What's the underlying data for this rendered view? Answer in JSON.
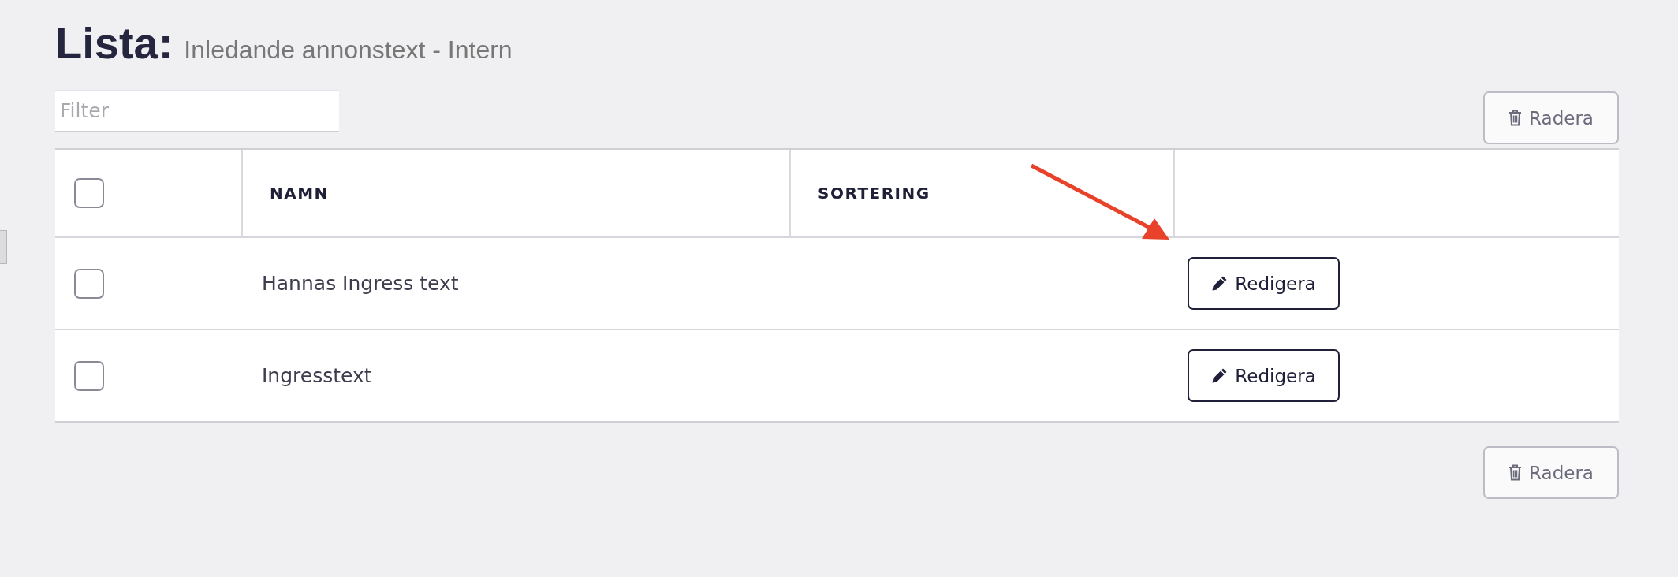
{
  "title": {
    "heading": "Lista:",
    "subtitle": "Inledande annonstext - Intern"
  },
  "filter": {
    "placeholder": "Filter"
  },
  "top_actions": {
    "delete_button": "Radera"
  },
  "table": {
    "select_all": {
      "checked": false
    },
    "columns": [
      "NAMN",
      "SORTERING"
    ],
    "rows": [
      {
        "checked": false,
        "name": "Hannas Ingress text",
        "action": "Redigera"
      },
      {
        "checked": false,
        "name": "Ingresstext",
        "action": "Redigera"
      }
    ]
  },
  "bottom_actions": {
    "delete_button": "Radera"
  }
}
